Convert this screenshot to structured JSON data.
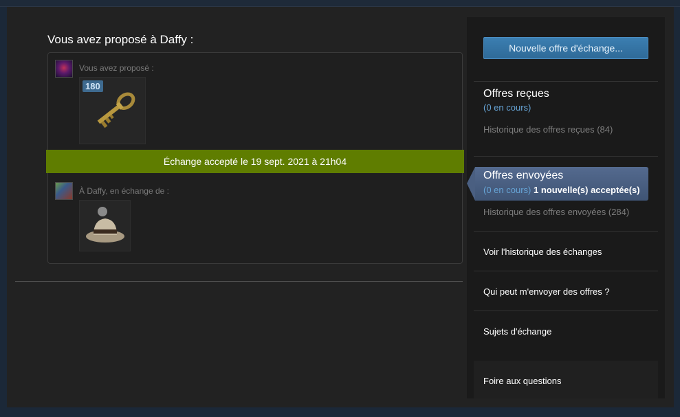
{
  "offer": {
    "title": "Vous avez proposé à Daffy :",
    "you_offered_label": "Vous avez proposé :",
    "key_quantity": "180",
    "status_banner": "Échange accepté le 19 sept. 2021 à 21h04",
    "in_exchange_label": "À Daffy, en échange de :"
  },
  "sidebar": {
    "new_offer_button": "Nouvelle offre d'échange...",
    "received": {
      "heading": "Offres reçues",
      "pending": "(0 en cours)",
      "history": "Historique des offres reçues (84)"
    },
    "sent": {
      "heading": "Offres envoyées",
      "pending": "(0 en cours)",
      "accepted": "1 nouvelle(s) acceptée(s)",
      "history": "Historique des offres envoyées (284)"
    },
    "links": {
      "trade_history": "Voir l'historique des échanges",
      "who_can_send": "Qui peut m'envoyer des offres ?",
      "trade_topics": "Sujets d'échange",
      "faq": "Foire aux questions"
    }
  },
  "colors": {
    "accepted_banner": "#5f7d00",
    "accent_blue": "#66a4d6",
    "button_blue": "#3b7eb1",
    "active_tab": "#546a8f"
  },
  "icons": [
    "key-icon",
    "hat-icon",
    "user-avatar",
    "daffy-avatar"
  ]
}
